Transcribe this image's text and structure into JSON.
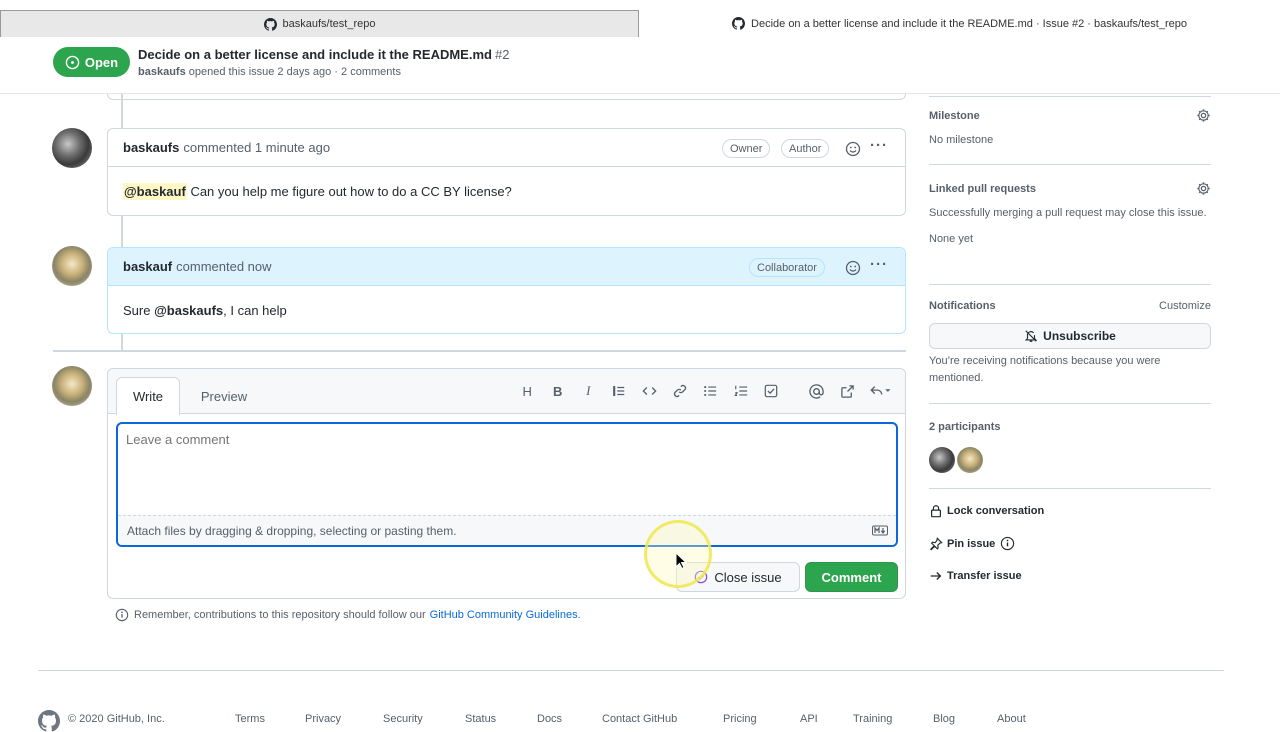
{
  "tabs": [
    {
      "label": "baskaufs/test_repo"
    },
    {
      "label": "Decide on a better license and include it the README.md · Issue #2 · baskaufs/test_repo"
    }
  ],
  "header": {
    "status": "Open",
    "title": "Decide on a better license and include it the README.md",
    "number": "#2",
    "author": "baskaufs",
    "meta_rest": "opened this issue 2 days ago · 2 comments"
  },
  "comments": [
    {
      "author": "baskaufs",
      "time": "commented 1 minute ago",
      "labels": [
        "Owner",
        "Author"
      ],
      "mention": "@baskauf",
      "body_rest": "Can you help me figure out how to do a CC BY license?"
    },
    {
      "author": "baskauf",
      "time": "commented now",
      "labels": [
        "Collaborator"
      ],
      "body_prefix": "Sure",
      "mention": "@baskaufs",
      "body_rest": ", I can help"
    }
  ],
  "form": {
    "tab_write": "Write",
    "tab_preview": "Preview",
    "toolbar_header": "H",
    "toolbar_bold": "B",
    "toolbar_italic": "I",
    "placeholder": "Leave a comment",
    "attach_text": "Attach files by dragging & dropping, selecting or pasting them.",
    "close_label": "Close issue",
    "comment_label": "Comment"
  },
  "guidelines": {
    "text": "Remember, contributions to this repository should follow our",
    "link": "GitHub Community Guidelines",
    "end": "."
  },
  "sidebar": {
    "milestone_h": "Milestone",
    "milestone_v": "No milestone",
    "linked_h": "Linked pull requests",
    "linked_desc": "Successfully merging a pull request may close this issue.",
    "linked_v": "None yet",
    "notif_h": "Notifications",
    "notif_customize": "Customize",
    "unsubscribe": "Unsubscribe",
    "notif_desc": "You’re receiving notifications because you were mentioned.",
    "participants_h": "2 participants",
    "lock": "Lock conversation",
    "pin": "Pin issue",
    "transfer": "Transfer issue"
  },
  "footer": [
    "© 2020 GitHub, Inc.",
    "Terms",
    "Privacy",
    "Security",
    "Status",
    "Docs",
    "Contact GitHub",
    "Pricing",
    "API",
    "Training",
    "Blog",
    "About"
  ],
  "colors": {
    "green": "#2da44e",
    "blue_head": "#ddf4ff",
    "link": "#0969da",
    "mention_bg": "#fff8c5"
  }
}
